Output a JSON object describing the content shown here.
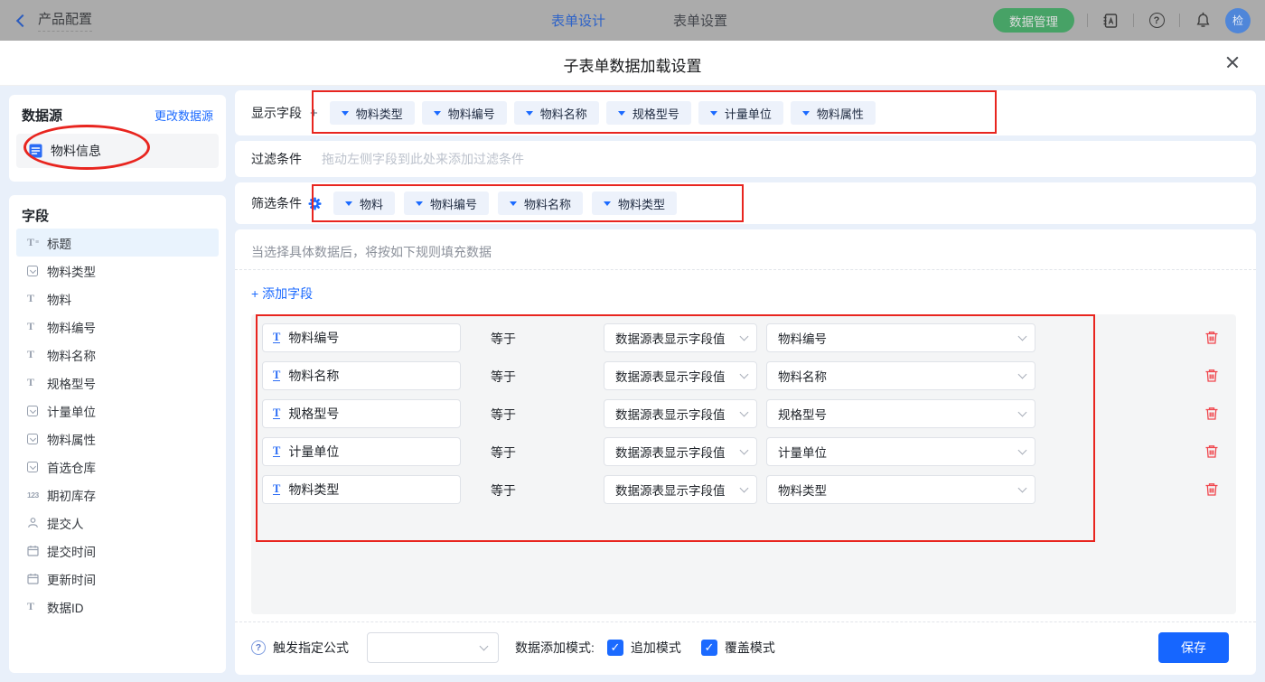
{
  "topbar": {
    "back_label": "产品配置",
    "tabs": [
      {
        "label": "表单设计",
        "active": true
      },
      {
        "label": "表单设置",
        "active": false
      }
    ],
    "data_manage_button": "数据管理",
    "avatar_text": "检"
  },
  "modal": {
    "title": "子表单数据加载设置"
  },
  "datasource": {
    "title": "数据源",
    "change_link": "更改数据源",
    "item_label": "物料信息",
    "item_icon": "form-doc-icon"
  },
  "fields_panel": {
    "title": "字段",
    "fields": [
      {
        "icon": "title-icon",
        "label": "标题",
        "selected": true
      },
      {
        "icon": "select-icon",
        "label": "物料类型"
      },
      {
        "icon": "text-input-icon",
        "label": "物料"
      },
      {
        "icon": "text-input-icon",
        "label": "物料编号"
      },
      {
        "icon": "text-input-icon",
        "label": "物料名称"
      },
      {
        "icon": "text-input-icon",
        "label": "规格型号"
      },
      {
        "icon": "select-icon",
        "label": "计量单位"
      },
      {
        "icon": "select-icon",
        "label": "物料属性"
      },
      {
        "icon": "select-icon",
        "label": "首选仓库"
      },
      {
        "icon": "number-icon",
        "label": "期初库存"
      },
      {
        "icon": "person-icon",
        "label": "提交人"
      },
      {
        "icon": "datetime-icon",
        "label": "提交时间"
      },
      {
        "icon": "datetime-icon",
        "label": "更新时间"
      },
      {
        "icon": "text-input-icon",
        "label": "数据ID"
      }
    ]
  },
  "display_fields": {
    "label": "显示字段",
    "tags": [
      "物料类型",
      "物料编号",
      "物料名称",
      "规格型号",
      "计量单位",
      "物料属性"
    ]
  },
  "filter_condition": {
    "label": "过滤条件",
    "placeholder": "拖动左侧字段到此处来添加过滤条件"
  },
  "screening_condition": {
    "label": "筛选条件",
    "tags": [
      "物料",
      "物料编号",
      "物料名称",
      "物料类型"
    ]
  },
  "rules": {
    "hint": "当选择具体数据后，将按如下规则填充数据",
    "add_field_label": "添加字段",
    "equals_label": "等于",
    "source_option": "数据源表显示字段值",
    "rows": [
      {
        "field": "物料编号",
        "target": "物料编号"
      },
      {
        "field": "物料名称",
        "target": "物料名称"
      },
      {
        "field": "规格型号",
        "target": "规格型号"
      },
      {
        "field": "计量单位",
        "target": "计量单位"
      },
      {
        "field": "物料类型",
        "target": "物料类型"
      }
    ]
  },
  "footer": {
    "formula_label": "触发指定公式",
    "formula_value": "",
    "mode_label": "数据添加模式:",
    "append_mode": "追加模式",
    "overwrite_mode": "覆盖模式",
    "save_label": "保存"
  },
  "glyphs": {
    "plus": "+",
    "help": "?",
    "text_input": "T",
    "title": "T",
    "number": "123"
  },
  "colors": {
    "accent_blue": "#1b6aff",
    "green": "#47a266",
    "annotation_red": "#e8251f",
    "save_blue": "#1666ff"
  }
}
